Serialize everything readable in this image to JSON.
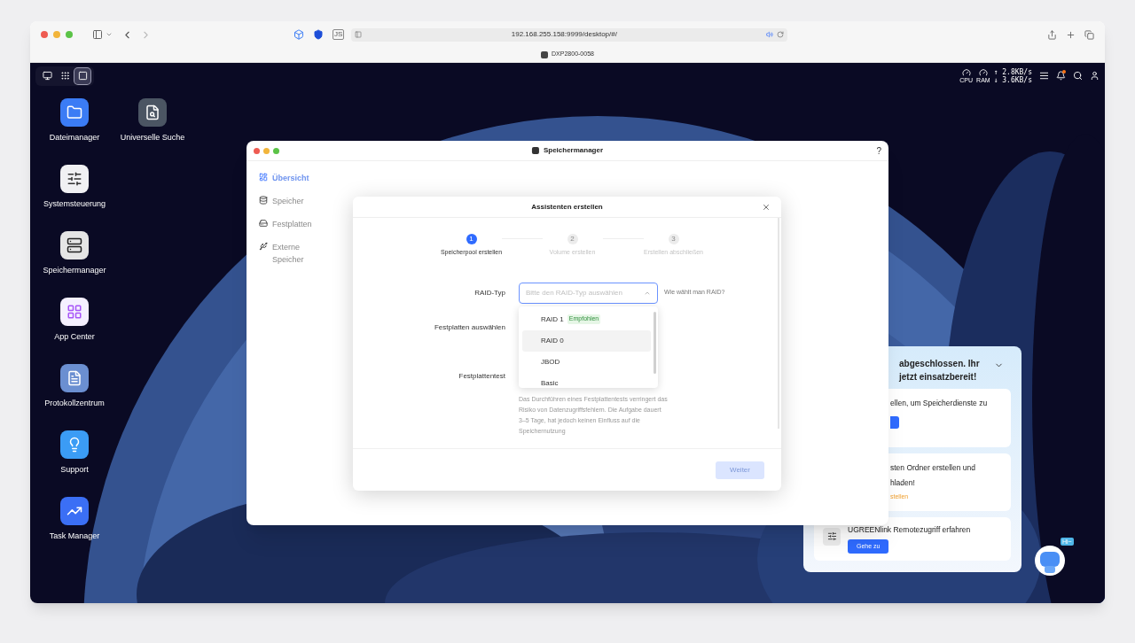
{
  "browser": {
    "extensions": [
      "JS"
    ],
    "url": "192.168.255.158:9999/desktop/#/",
    "tab_title": "DXP2800-0058"
  },
  "topbar": {
    "launchers": [
      {
        "selected": false
      },
      {
        "selected": false
      },
      {
        "selected": true
      }
    ],
    "cpu_label": "CPU",
    "ram_label": "RAM",
    "upload": "↑ 2.8KB/s",
    "download": "↓ 3.6KB/s",
    "notifications_unread": true
  },
  "desktop_apps": [
    {
      "label": "Dateimanager"
    },
    {
      "label": "Universelle Suche"
    },
    {
      "label": "Systemsteuerung"
    },
    {
      "label": "Speichermanager"
    },
    {
      "label": "App Center"
    },
    {
      "label": "Protokollzentrum"
    },
    {
      "label": "Support"
    },
    {
      "label": "Task Manager"
    }
  ],
  "window": {
    "title": "Speichermanager",
    "help": "?",
    "sidebar": [
      {
        "label": "Übersicht",
        "selected": true
      },
      {
        "label": "Speicher",
        "selected": false
      },
      {
        "label": "Festplatten",
        "selected": false
      },
      {
        "label": "Externe Speicher",
        "selected": false
      }
    ]
  },
  "dialog": {
    "title": "Assistenten erstellen",
    "steps": [
      {
        "number": "1",
        "label": "Speicherpool erstellen",
        "active": true
      },
      {
        "number": "2",
        "label": "Volume erstellen",
        "active": false
      },
      {
        "number": "3",
        "label": "Erstellen abschließen",
        "active": false
      }
    ],
    "raid_label": "RAID-Typ",
    "raid_placeholder": "Bitte den RAID-Typ auswählen",
    "raid_help": "Wie wählt man RAID?",
    "options": [
      {
        "label": "RAID 1",
        "badge": "Empfohlen",
        "highlighted": false
      },
      {
        "label": "RAID 0",
        "highlighted": true
      },
      {
        "label": "JBOD",
        "highlighted": false
      },
      {
        "label": "Basic",
        "highlighted": false
      }
    ],
    "disks_label": "Festplatten auswählen",
    "test_label": "Festplattentest",
    "test_description": "Das Durchführen eines Festplattentests verringert das Risiko von Datenzugriffsfehlern. Die Aufgabe dauert 3–5 Tage, hat jedoch keinen Einfluss auf die Speichernutzung",
    "next_button": {
      "label": "Weiter",
      "disabled": true
    }
  },
  "onboarding": {
    "title_lines": [
      "abgeschlossen. Ihr",
      "jetzt einsatzbereit!"
    ],
    "cards": [
      {
        "kind": "stub",
        "lines": [
          "ellen, um Speicherdienste zu"
        ]
      },
      {
        "kind": "link",
        "lines": [
          "sten Ordner erstellen und",
          "hladen!"
        ],
        "link": "stellen"
      },
      {
        "kind": "button",
        "lines": [
          "UGREENlink Remotezugriff erfahren"
        ],
        "button": "Gehe zu"
      }
    ]
  },
  "assistant": {
    "bubble": "Hi~"
  }
}
